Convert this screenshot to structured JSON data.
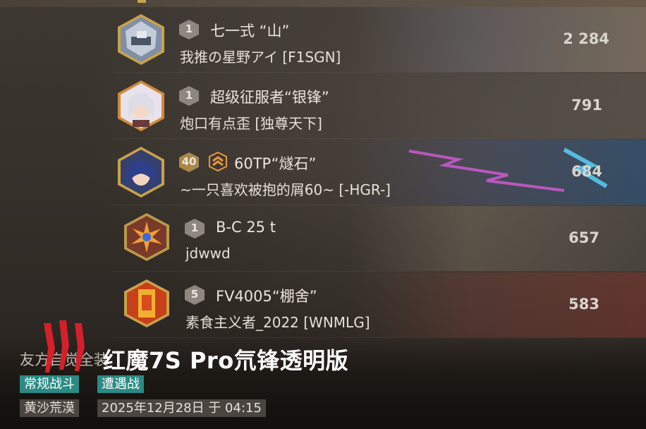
{
  "rows": [
    {
      "tier": "1",
      "rank_icon": "",
      "vehicle": "七一式 “山”",
      "player": "我推の星野アイ [F1SGN]",
      "score": "2 284",
      "avatar": "tank-crew-avatar-icon"
    },
    {
      "tier": "1",
      "rank_icon": "",
      "vehicle": "超级征服者“银锋”",
      "player": "炮口有点歪 [独尊天下]",
      "score": "791",
      "avatar": "white-haired-girl-avatar-icon"
    },
    {
      "tier": "40",
      "rank_icon": "rank-chevrons-icon",
      "vehicle": "60TP“燧石”",
      "player": "~一只喜欢被抱的屑60~ [-HGR-]",
      "score": "684",
      "avatar": "blue-haired-girl-avatar-icon"
    },
    {
      "tier": "1",
      "rank_icon": "",
      "vehicle": "B-C 25 t",
      "player": "jdwwd",
      "score": "657",
      "avatar": "starburst-emblem-icon"
    },
    {
      "tier": "5",
      "rank_icon": "",
      "vehicle": "FV4005“棚舍”",
      "player": "素食主义者_2022 [WNMLG]",
      "score": "583",
      "avatar": "golden-card-avatar-icon"
    }
  ],
  "footer": {
    "team_title": "友方自觉全装",
    "watermark": "红魔7S Pro氘锋透明版",
    "tag_mode": "常规战斗",
    "tag_type": "遭遇战",
    "map": "黄沙荒漠",
    "datetime": "2025年12月28日 于 04:15"
  },
  "colors": {
    "tag_teal": "#2c8a84",
    "gold_badge": "#c9a24a",
    "logo_red": "#d4202a"
  }
}
